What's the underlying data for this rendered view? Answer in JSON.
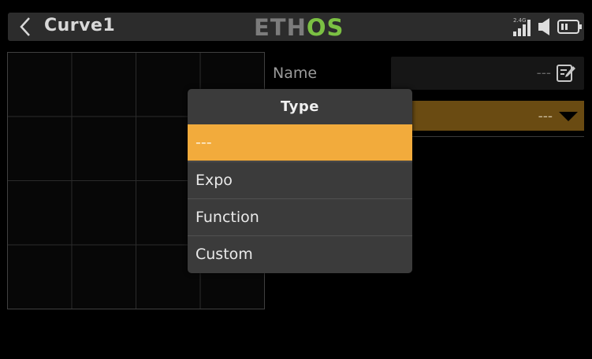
{
  "header": {
    "title": "Curve1",
    "logo_part1": "ETH",
    "logo_part2": "OS",
    "signal_band": "2.4G"
  },
  "form": {
    "name_label": "Name",
    "name_value": "---",
    "type_value": "---"
  },
  "popup": {
    "title": "Type",
    "options": [
      {
        "label": "---",
        "selected": true
      },
      {
        "label": "Expo",
        "selected": false
      },
      {
        "label": "Function",
        "selected": false
      },
      {
        "label": "Custom",
        "selected": false
      }
    ]
  },
  "colors": {
    "accent": "#f2ab3c",
    "logo_green": "#7bc043",
    "selected_field": "#6a4b12"
  }
}
